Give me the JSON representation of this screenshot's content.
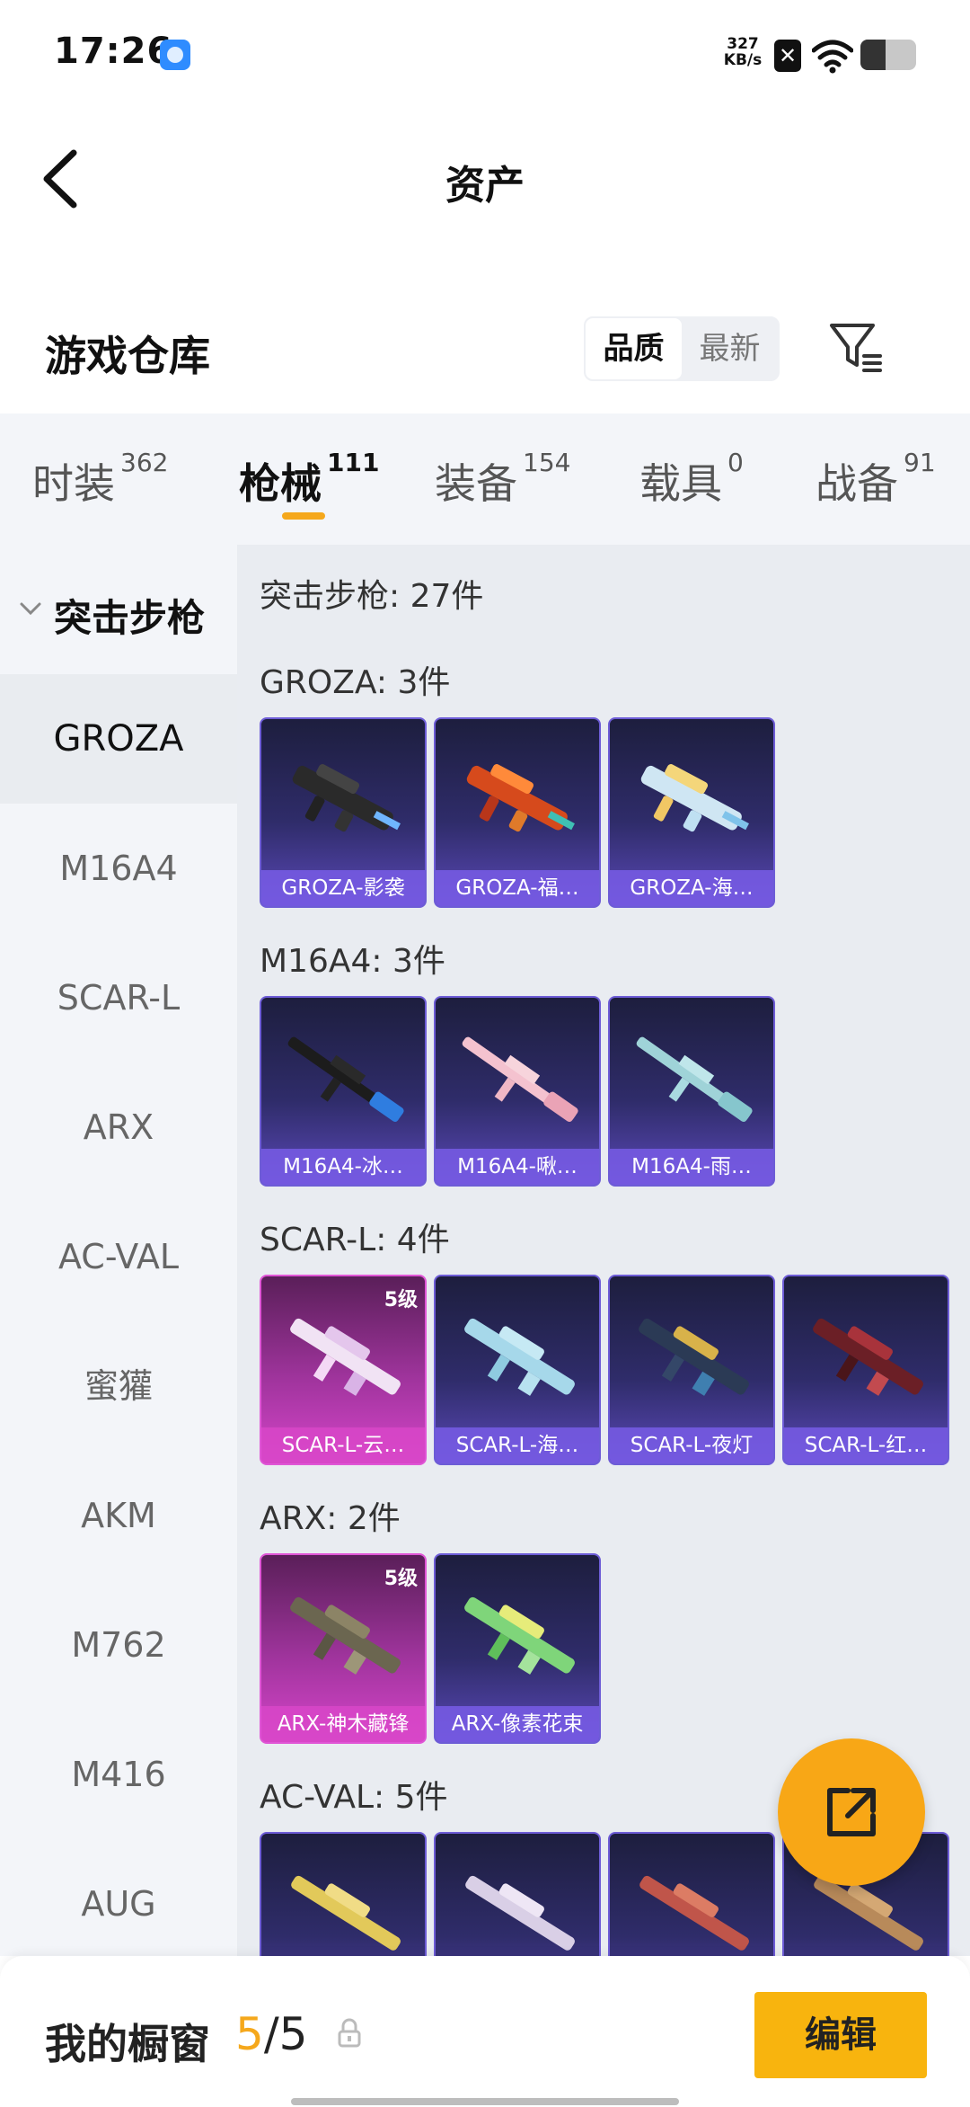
{
  "status_bar": {
    "time": "17:26",
    "net_speed_value": "327",
    "net_speed_unit": "KB/s",
    "battery_level": 0.45,
    "icons": [
      "app-notification-icon",
      "x-icon",
      "wifi-icon",
      "battery-icon"
    ]
  },
  "header": {
    "back_icon": "back-arrow-icon",
    "title": "资产"
  },
  "warehouse": {
    "title": "游戏仓库",
    "sort_options": [
      "品质",
      "最新"
    ],
    "selected_sort": "品质",
    "filter_icon": "filter-icon"
  },
  "tabs": [
    {
      "label": "时装",
      "count": "362"
    },
    {
      "label": "枪械",
      "count": "111",
      "active": true
    },
    {
      "label": "装备",
      "count": "154"
    },
    {
      "label": "载具",
      "count": "0"
    },
    {
      "label": "战备",
      "count": "91"
    }
  ],
  "sidebar": {
    "group": "突击步枪",
    "items": [
      "GROZA",
      "M16A4",
      "SCAR-L",
      "ARX",
      "AC-VAL",
      "蜜獾",
      "AKM",
      "M762",
      "M416",
      "AUG"
    ],
    "selected": "GROZA"
  },
  "content": {
    "total": "突击步枪: 27件",
    "sections": [
      {
        "label": "GROZA: 3件",
        "items": [
          {
            "name": "GROZA-影袭",
            "rarity": "purple"
          },
          {
            "name": "GROZA-福…",
            "rarity": "purple"
          },
          {
            "name": "GROZA-海…",
            "rarity": "purple"
          }
        ]
      },
      {
        "label": "M16A4: 3件",
        "items": [
          {
            "name": "M16A4-冰…",
            "rarity": "purple"
          },
          {
            "name": "M16A4-啾…",
            "rarity": "purple"
          },
          {
            "name": "M16A4-雨…",
            "rarity": "purple"
          }
        ]
      },
      {
        "label": "SCAR-L: 4件",
        "items": [
          {
            "name": "SCAR-L-云…",
            "rarity": "gold",
            "tier": "5级"
          },
          {
            "name": "SCAR-L-海…",
            "rarity": "purple"
          },
          {
            "name": "SCAR-L-夜灯",
            "rarity": "purple"
          },
          {
            "name": "SCAR-L-红…",
            "rarity": "purple"
          }
        ]
      },
      {
        "label": "ARX: 2件",
        "items": [
          {
            "name": "ARX-神木藏锋",
            "rarity": "gold",
            "tier": "5级"
          },
          {
            "name": "ARX-像素花束",
            "rarity": "purple"
          }
        ]
      },
      {
        "label": "AC-VAL: 5件",
        "items": [
          {
            "name": "",
            "rarity": "purple"
          },
          {
            "name": "",
            "rarity": "purple"
          },
          {
            "name": "",
            "rarity": "purple"
          },
          {
            "name": "",
            "rarity": "purple"
          }
        ]
      }
    ]
  },
  "fab": {
    "icon": "share-icon"
  },
  "bottom_bar": {
    "label": "我的橱窗",
    "count_current": "5",
    "count_sep": "/",
    "count_total": "5",
    "lock_icon": "lock-icon",
    "edit_label": "编辑"
  },
  "colors": {
    "accent": "#f5a81c",
    "purple_card": "#5a48b7",
    "gold_card": "#d545c9"
  }
}
